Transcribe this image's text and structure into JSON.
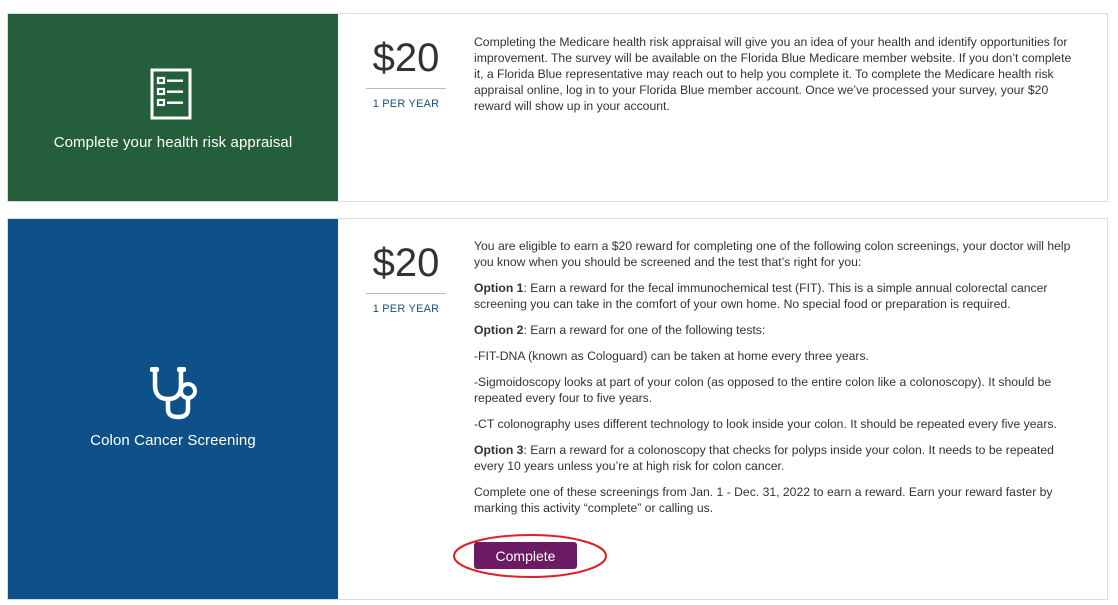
{
  "cards": [
    {
      "title": "Complete your health risk appraisal",
      "icon": "document-list-icon",
      "amount": "$20",
      "frequency": "1 PER YEAR",
      "description": "Completing the Medicare health risk appraisal will give you an idea of your health and identify opportunities for improvement. The survey will be available on the Florida Blue Medicare member website. If you don’t complete it, a Florida Blue representative may reach out to help you complete it. To complete the Medicare health risk appraisal online, log in to your Florida Blue member account. Once we’ve processed your survey, your $20 reward will show up in your account.",
      "panel_color": "#245e3a"
    },
    {
      "title": "Colon Cancer Screening",
      "icon": "stethoscope-icon",
      "amount": "$20",
      "frequency": "1 PER YEAR",
      "panel_color": "#0e5188",
      "intro": "You are eligible to earn a $20 reward for completing one of the following colon screenings, your doctor will help you know when you should be screened and the test that’s right for you:",
      "option1_label": "Option 1",
      "option1_text": ": Earn a reward for the fecal immunochemical test (FIT). This is a simple annual colorectal cancer screening you can take in the comfort of your own home. No special food or preparation is required.",
      "option2_label": "Option 2",
      "option2_text": ": Earn a reward for one of the following tests:",
      "fit_dna": "-FIT-DNA (known as Cologuard) can be taken at home every three years.",
      "sigmoidoscopy": "-Sigmoidoscopy looks at part of your colon (as opposed to the entire colon like a colonoscopy). It should be repeated every four to five years.",
      "ct": "-CT colonography uses different technology to look inside your colon. It should be repeated every five years.",
      "option3_label": "Option 3",
      "option3_text": ": Earn a reward for a colonoscopy that checks for polyps  inside your colon. It needs to be repeated every 10 years unless you’re at high risk for colon cancer.",
      "closing": "Complete one of these screenings from Jan. 1 - Dec. 31, 2022 to earn a reward. Earn your reward faster by marking this activity “complete” or calling us.",
      "button_label": "Complete",
      "button_color": "#6b1a63"
    }
  ],
  "annotation_color": "#d9222a"
}
